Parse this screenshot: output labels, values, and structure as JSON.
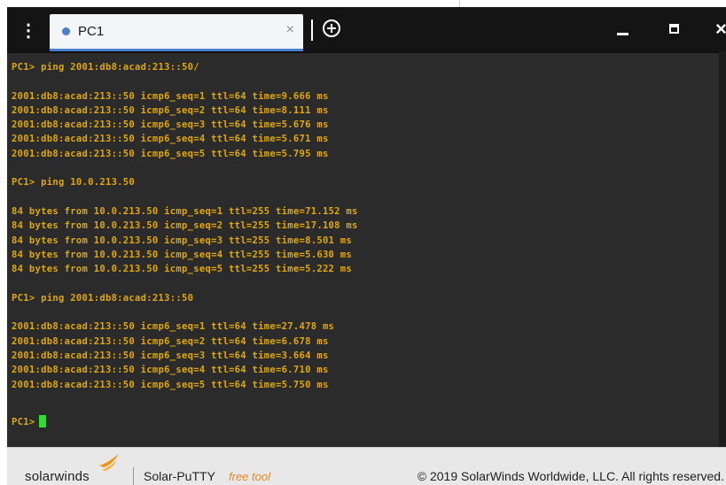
{
  "titlebar": {
    "menu_icon": "vertical-ellipsis-icon",
    "tab": {
      "label": "PC1",
      "status_color": "#4a7ccf",
      "close_glyph": "×"
    },
    "new_tab_icon": "circle-plus-icon",
    "controls": {
      "minimize_icon": "minimize-icon",
      "maximize_icon": "maximize-icon",
      "close_glyph": "×"
    }
  },
  "terminal": {
    "text_color": "#e0a800",
    "background": "#2b2b2b",
    "cursor_color": "#2ee02e",
    "lines": [
      "PC1> ping 2001:db8:acad:213::50/",
      "",
      "2001:db8:acad:213::50 icmp6_seq=1 ttl=64 time=9.666 ms",
      "2001:db8:acad:213::50 icmp6_seq=2 ttl=64 time=8.111 ms",
      "2001:db8:acad:213::50 icmp6_seq=3 ttl=64 time=5.676 ms",
      "2001:db8:acad:213::50 icmp6_seq=4 ttl=64 time=5.671 ms",
      "2001:db8:acad:213::50 icmp6_seq=5 ttl=64 time=5.795 ms",
      "",
      "PC1> ping 10.0.213.50",
      "",
      "84 bytes from 10.0.213.50 icmp_seq=1 ttl=255 time=71.152 ms",
      "84 bytes from 10.0.213.50 icmp_seq=2 ttl=255 time=17.108 ms",
      "84 bytes from 10.0.213.50 icmp_seq=3 ttl=255 time=8.501 ms",
      "84 bytes from 10.0.213.50 icmp_seq=4 ttl=255 time=5.630 ms",
      "84 bytes from 10.0.213.50 icmp_seq=5 ttl=255 time=5.222 ms",
      "",
      "PC1> ping 2001:db8:acad:213::50",
      "",
      "2001:db8:acad:213::50 icmp6_seq=1 ttl=64 time=27.478 ms",
      "2001:db8:acad:213::50 icmp6_seq=2 ttl=64 time=6.678 ms",
      "2001:db8:acad:213::50 icmp6_seq=3 ttl=64 time=3.664 ms",
      "2001:db8:acad:213::50 icmp6_seq=4 ttl=64 time=6.710 ms",
      "2001:db8:acad:213::50 icmp6_seq=5 ttl=64 time=5.750 ms"
    ],
    "prompt": "PC1>"
  },
  "footer": {
    "brand": "solarwinds",
    "brand_icon": "solarwinds-flame-icon",
    "product": "Solar-PuTTY",
    "product_tag": "free tool",
    "copyright": "© 2019 SolarWinds Worldwide, LLC. All rights reserved."
  }
}
